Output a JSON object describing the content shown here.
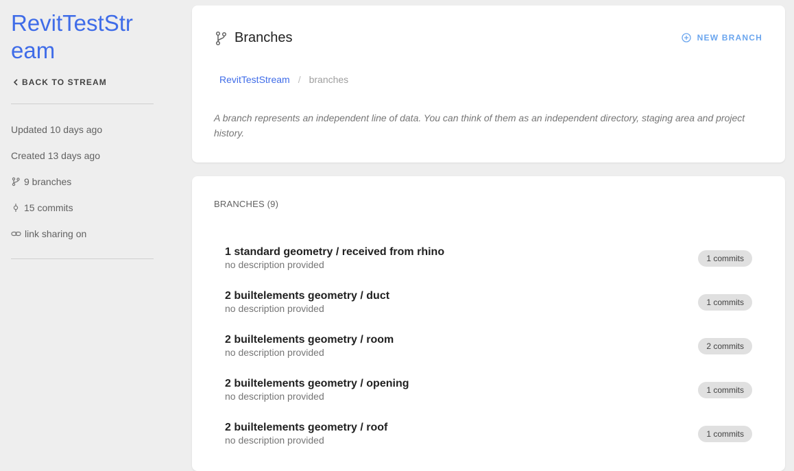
{
  "sidebar": {
    "stream_title": "RevitTestStream",
    "back_label": "BACK TO STREAM",
    "meta": {
      "updated": "Updated 10 days ago",
      "created": "Created 13 days ago",
      "branches": "9 branches",
      "commits": "15 commits",
      "sharing": "link sharing on"
    }
  },
  "header": {
    "title": "Branches",
    "new_branch_label": "NEW BRANCH",
    "breadcrumb": {
      "stream": "RevitTestStream",
      "separator": "/",
      "current": "branches"
    },
    "description": "A branch represents an independent line of data. You can think of them as an independent directory, staging area and project history."
  },
  "list": {
    "heading": "BRANCHES (9)",
    "items": [
      {
        "name": "1 standard geometry / received from rhino",
        "description": "no description provided",
        "commits": "1 commits"
      },
      {
        "name": "2 builtelements geometry / duct",
        "description": "no description provided",
        "commits": "1 commits"
      },
      {
        "name": "2 builtelements geometry / room",
        "description": "no description provided",
        "commits": "2 commits"
      },
      {
        "name": "2 builtelements geometry / opening",
        "description": "no description provided",
        "commits": "1 commits"
      },
      {
        "name": "2 builtelements geometry / roof",
        "description": "no description provided",
        "commits": "1 commits"
      }
    ]
  },
  "colors": {
    "accent": "#3f6ce8",
    "new_branch": "#6aa5ee",
    "background": "#eeeeee",
    "chip": "#e0e0e0"
  },
  "icons": {
    "back": "chevron-left-icon",
    "branch": "source-branch-icon",
    "commit": "commit-icon",
    "link": "link-icon",
    "new": "plus-circle-icon"
  }
}
